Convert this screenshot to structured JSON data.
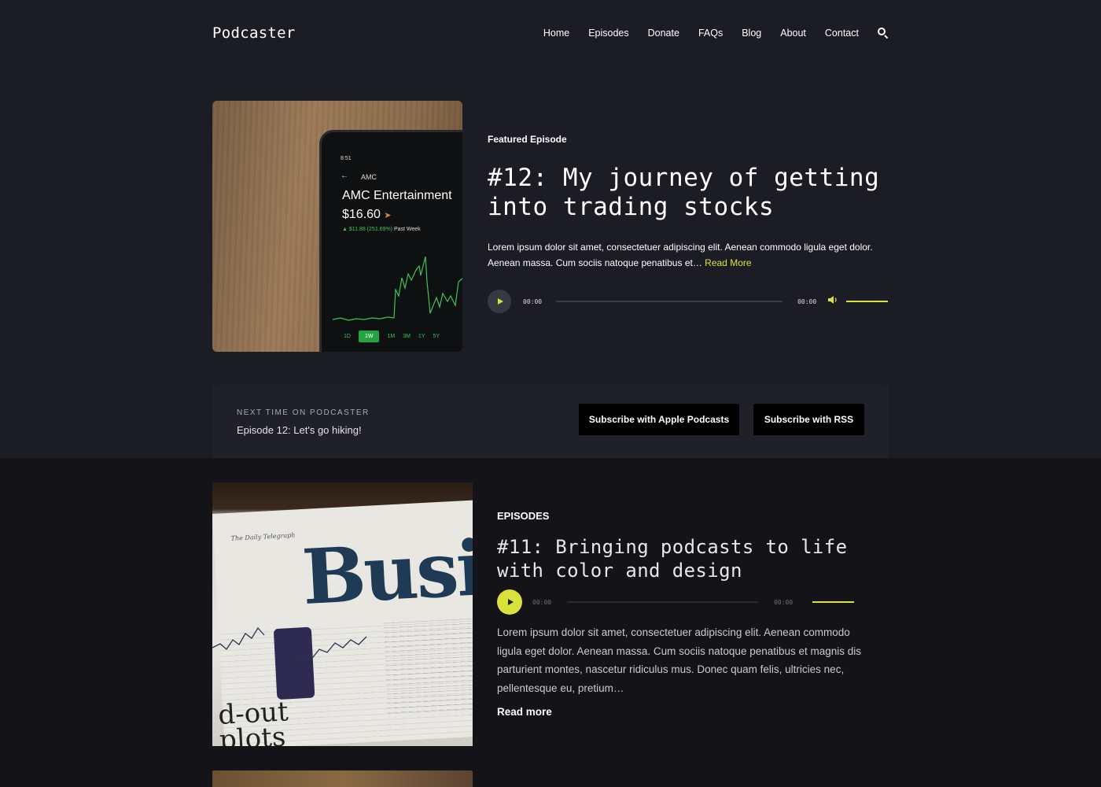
{
  "header": {
    "logo": "Podcaster",
    "nav": [
      "Home",
      "Episodes",
      "Donate",
      "FAQs",
      "Blog",
      "About",
      "Contact"
    ],
    "search_icon": "search-icon"
  },
  "featured": {
    "label": "Featured Episode",
    "title": "#12: My journey of getting into trading stocks",
    "description": "Lorem ipsum dolor sit amet, consectetuer adipiscing elit. Aenean commodo ligula eget dolor. Aenean massa. Cum sociis natoque penatibus et…",
    "read_more": "Read More",
    "player": {
      "current_time": "00:00",
      "duration": "00:00",
      "progress": 0,
      "volume": 1.0
    },
    "image": {
      "status": "8:51",
      "ticker": "AMC",
      "company": "AMC Entertainment",
      "price": "$16.60",
      "change": "▲ $11.88 (251.69%)",
      "period": "Past Week",
      "ranges": [
        "1D",
        "1W",
        "1M",
        "3M",
        "1Y",
        "5Y"
      ],
      "active_range": "1W"
    }
  },
  "next": {
    "label": "NEXT TIME ON PODCASTER",
    "title": "Episode 12: Let's go hiking!",
    "apple_button": "Subscribe with Apple Podcasts",
    "rss_button": "Subscribe with RSS"
  },
  "episodes": {
    "label": "EPISODES",
    "items": [
      {
        "title": "#11: Bringing podcasts to life with color and design",
        "player": {
          "current_time": "00:00",
          "duration": "00:00",
          "progress": 0,
          "volume": 1.0
        },
        "description": "Lorem ipsum dolor sit amet, consectetuer adipiscing elit. Aenean commodo ligula eget dolor. Aenean massa. Cum sociis natoque penatibus et magnis dis parturient montes, nascetur ridiculus mus. Donec quam felis, ultricies nec, pellentesque eu, pretium…",
        "read_more": "Read more",
        "image": {
          "masthead": "The Daily Telegraph",
          "headline": "Busi",
          "subhead": "d-out\nplots"
        }
      }
    ]
  },
  "colors": {
    "accent": "#d7e23a",
    "background": "#1c1d24",
    "lower_background": "#131318"
  }
}
